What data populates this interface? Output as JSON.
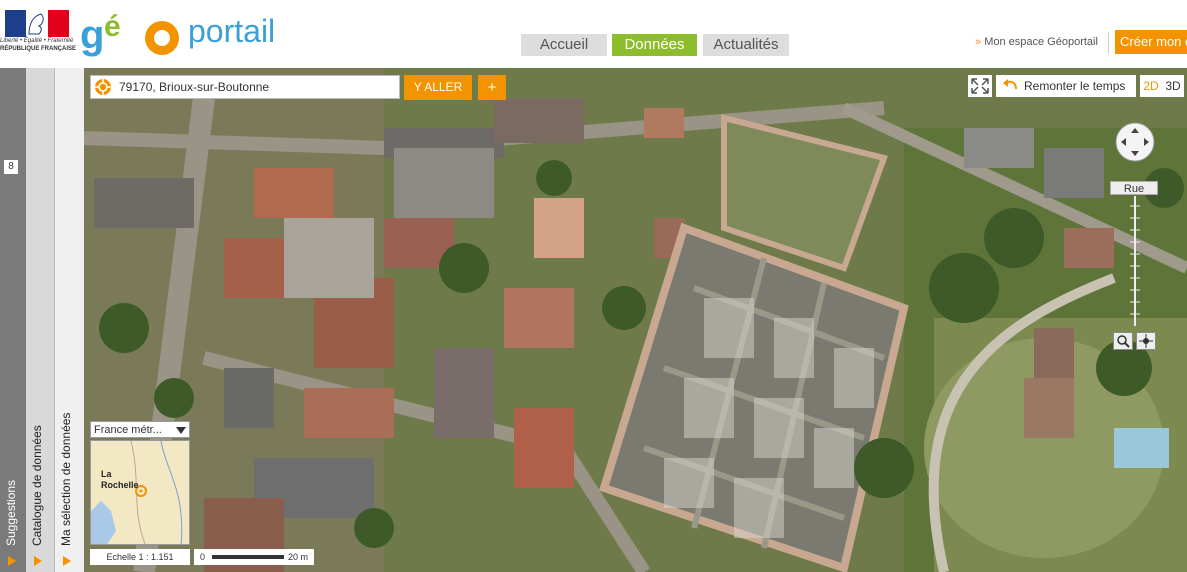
{
  "header": {
    "rf_line1": "Liberté • Égalité • Fraternité",
    "rf_line2": "RÉPUBLIQUE FRANÇAISE",
    "logo_geo": "géo",
    "logo_portail": "portail",
    "nav": [
      {
        "label": "Accueil",
        "active": false
      },
      {
        "label": "Données",
        "active": true
      },
      {
        "label": "Actualités",
        "active": false
      }
    ],
    "espace_arrow": "»",
    "espace_label": "Mon espace Géoportail",
    "creer_label": "Créer mon e"
  },
  "left_panels": {
    "badge": "8",
    "tab1": "Suggestions",
    "tab2": "Catalogue de données",
    "tab3": "Ma sélection de données"
  },
  "map": {
    "search_value": "79170, Brioux-sur-Boutonne",
    "search_button": "Y ALLER",
    "plus_button": "+",
    "remonter_label": "Remonter le temps",
    "btn_2d": "2D",
    "btn_3d": "3D",
    "rue_label": "Rue",
    "region_select": "France métr...",
    "minimap_label": "La Rochelle",
    "minimap_label_line1": "La",
    "minimap_label_line2": "Rochelle",
    "echelle": "Echelle 1 :  1.151",
    "scale_start": "0",
    "scale_end": "20 m",
    "accent_color": "#f29400",
    "active_nav_color": "#8dbd2c"
  }
}
